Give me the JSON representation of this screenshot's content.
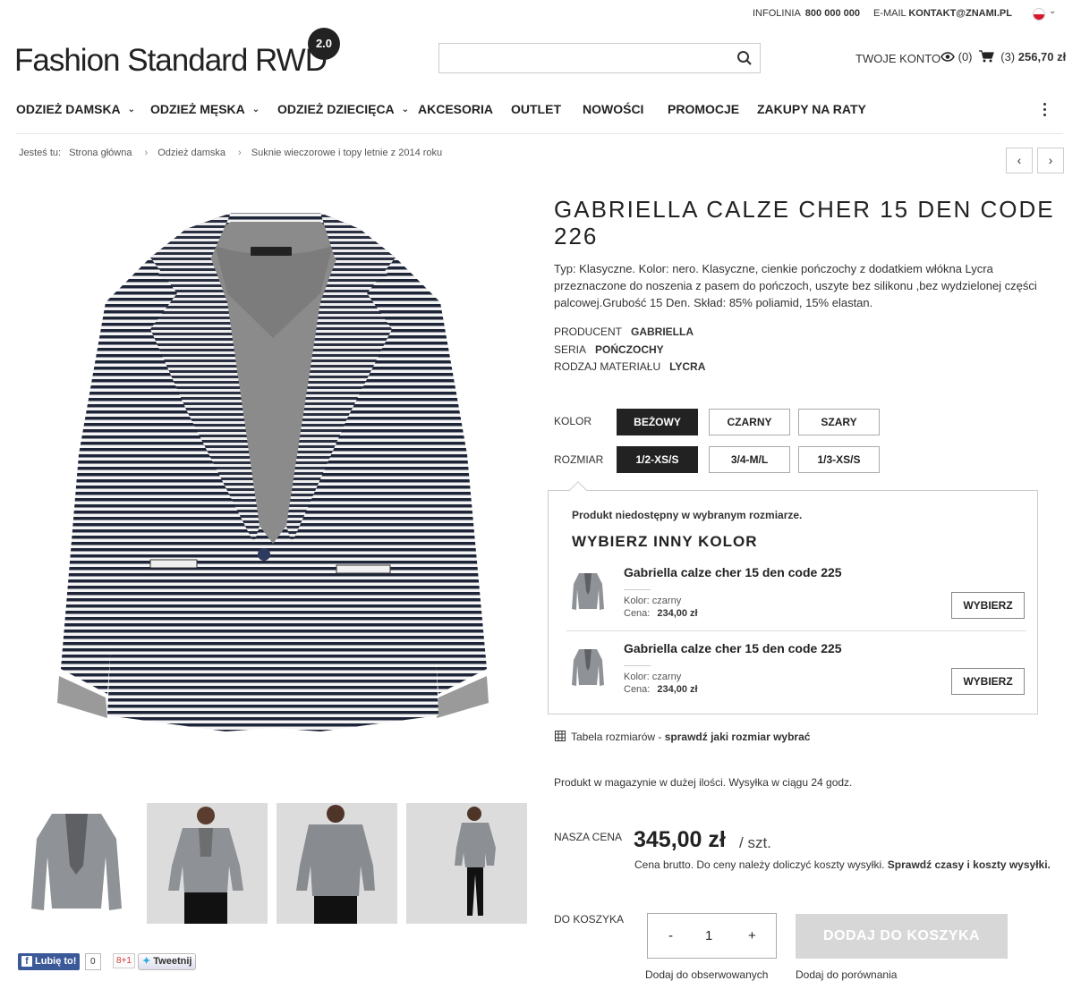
{
  "topbar": {
    "infolinia_label": "INFOLINIA",
    "infolinia_number": "800 000 000",
    "email_label": "E-MAIL",
    "email_value": "KONTAKT@ZNAMI.PL"
  },
  "logo": {
    "text": "Fashion Standard RWD",
    "badge": "2.0"
  },
  "search": {
    "placeholder": ""
  },
  "account": {
    "label": "TWOJE KONTO",
    "watch_count": "(0)",
    "cart_count": "(3)",
    "cart_total": "256,70 zł"
  },
  "nav": {
    "items": [
      {
        "label": "ODZIEŻ DAMSKA",
        "has_dropdown": true
      },
      {
        "label": "ODZIEŻ MĘSKA",
        "has_dropdown": true
      },
      {
        "label": "ODZIEŻ DZIECIĘCA",
        "has_dropdown": true
      },
      {
        "label": "AKCESORIA",
        "has_dropdown": false
      },
      {
        "label": "OUTLET",
        "has_dropdown": false
      },
      {
        "label": "NOWOŚCI",
        "has_dropdown": false
      },
      {
        "label": "PROMOCJE",
        "has_dropdown": false
      },
      {
        "label": "ZAKUPY NA RATY",
        "has_dropdown": false
      }
    ]
  },
  "breadcrumb": {
    "prefix": "Jesteś tu:",
    "items": [
      "Strona główna",
      "Odzież damska",
      "Suknie wieczorowe i topy letnie z 2014 roku"
    ]
  },
  "social": {
    "fb_like": "Lubię to!",
    "fb_count": "0",
    "gplus": "8+1",
    "tweet": "Tweetnij"
  },
  "product": {
    "title": "GABRIELLA CALZE CHER 15 DEN CODE 226",
    "description": "Typ: Klasyczne. Kolor: nero. Klasyczne, cienkie pończochy z dodatkiem włókna Lycra przeznaczone do noszenia z pasem do pończoch, uszyte bez silikonu ,bez wydzielonej części palcowej.Grubość 15 Den. Skład: 85% poliamid, 15% elastan.",
    "producer_label": "PRODUCENT",
    "producer": "GABRIELLA",
    "series_label": "SERIA",
    "series": "POŃCZOCHY",
    "material_label": "RODZAJ MATERIAŁU",
    "material": "LYCRA",
    "color_label": "KOLOR",
    "colors": [
      "BEŻOWY",
      "CZARNY",
      "SZARY"
    ],
    "selected_color": "BEŻOWY",
    "size_label": "ROZMIAR",
    "sizes": [
      "1/2-XS/S",
      "3/4-M/L",
      "1/3-XS/S"
    ],
    "selected_size": "1/2-XS/S"
  },
  "popup": {
    "message": "Produkt niedostępny w wybranym rozmiarze.",
    "title": "WYBIERZ INNY KOLOR",
    "alternatives": [
      {
        "name": "Gabriella calze cher 15 den code 225",
        "color": "Kolor: czarny",
        "price_label": "Cena:",
        "price": "234,00 zł",
        "button": "WYBIERZ"
      },
      {
        "name": "Gabriella calze cher 15 den code 225",
        "color": "Kolor: czarny",
        "price_label": "Cena:",
        "price": "234,00 zł",
        "button": "WYBIERZ"
      }
    ]
  },
  "size_table": {
    "label": "Tabela rozmiarów -",
    "link": "sprawdź jaki rozmiar wybrać"
  },
  "stock": "Produkt w magazynie w dużej ilości. Wysyłka w ciągu 24 godz.",
  "pricing": {
    "label": "NASZA CENA",
    "price": "345,00 zł",
    "unit": "/ szt.",
    "note": "Cena brutto. Do ceny należy doliczyć koszty wysyłki.",
    "note_link": "Sprawdź czasy i koszty wysyłki."
  },
  "cart": {
    "label": "DO KOSZYKA",
    "minus": "-",
    "quantity": "1",
    "plus": "+",
    "add_button": "DODAJ DO KOSZYKA",
    "watch_link": "Dodaj do obserwowanych",
    "compare_link": "Dodaj do porównania"
  }
}
